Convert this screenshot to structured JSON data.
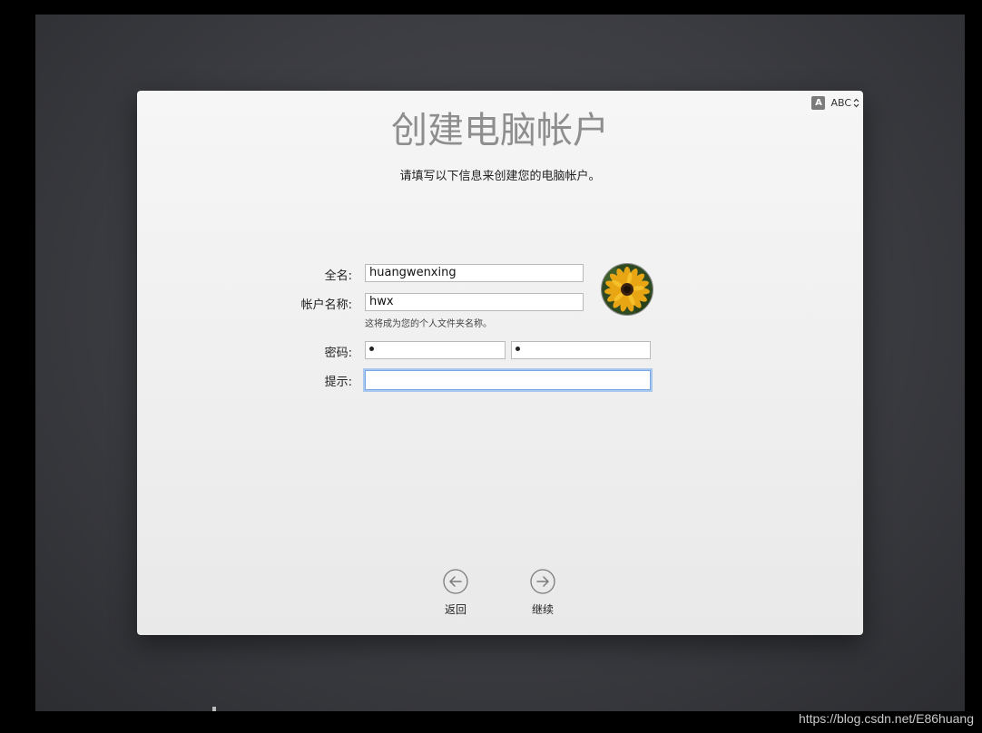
{
  "window": {
    "title": "创建电脑帐户",
    "subtitle": "请填写以下信息来创建您的电脑帐户。"
  },
  "input_source": {
    "badge": "A",
    "name": "ABC",
    "icon": "chevron-updown-icon"
  },
  "form": {
    "full_name_label": "全名:",
    "full_name_value": "huangwenxing",
    "account_name_label": "帐户名称:",
    "account_name_value": "hwx",
    "account_name_help": "这将成为您的个人文件夹名称。",
    "password_label": "密码:",
    "password_mask": "•",
    "verify_mask": "•",
    "hint_label": "提示:",
    "hint_value": ""
  },
  "avatar": {
    "icon": "sunflower-avatar"
  },
  "nav": {
    "back_label": "返回",
    "continue_label": "继续"
  },
  "watermark": "https://blog.csdn.net/E86huang"
}
